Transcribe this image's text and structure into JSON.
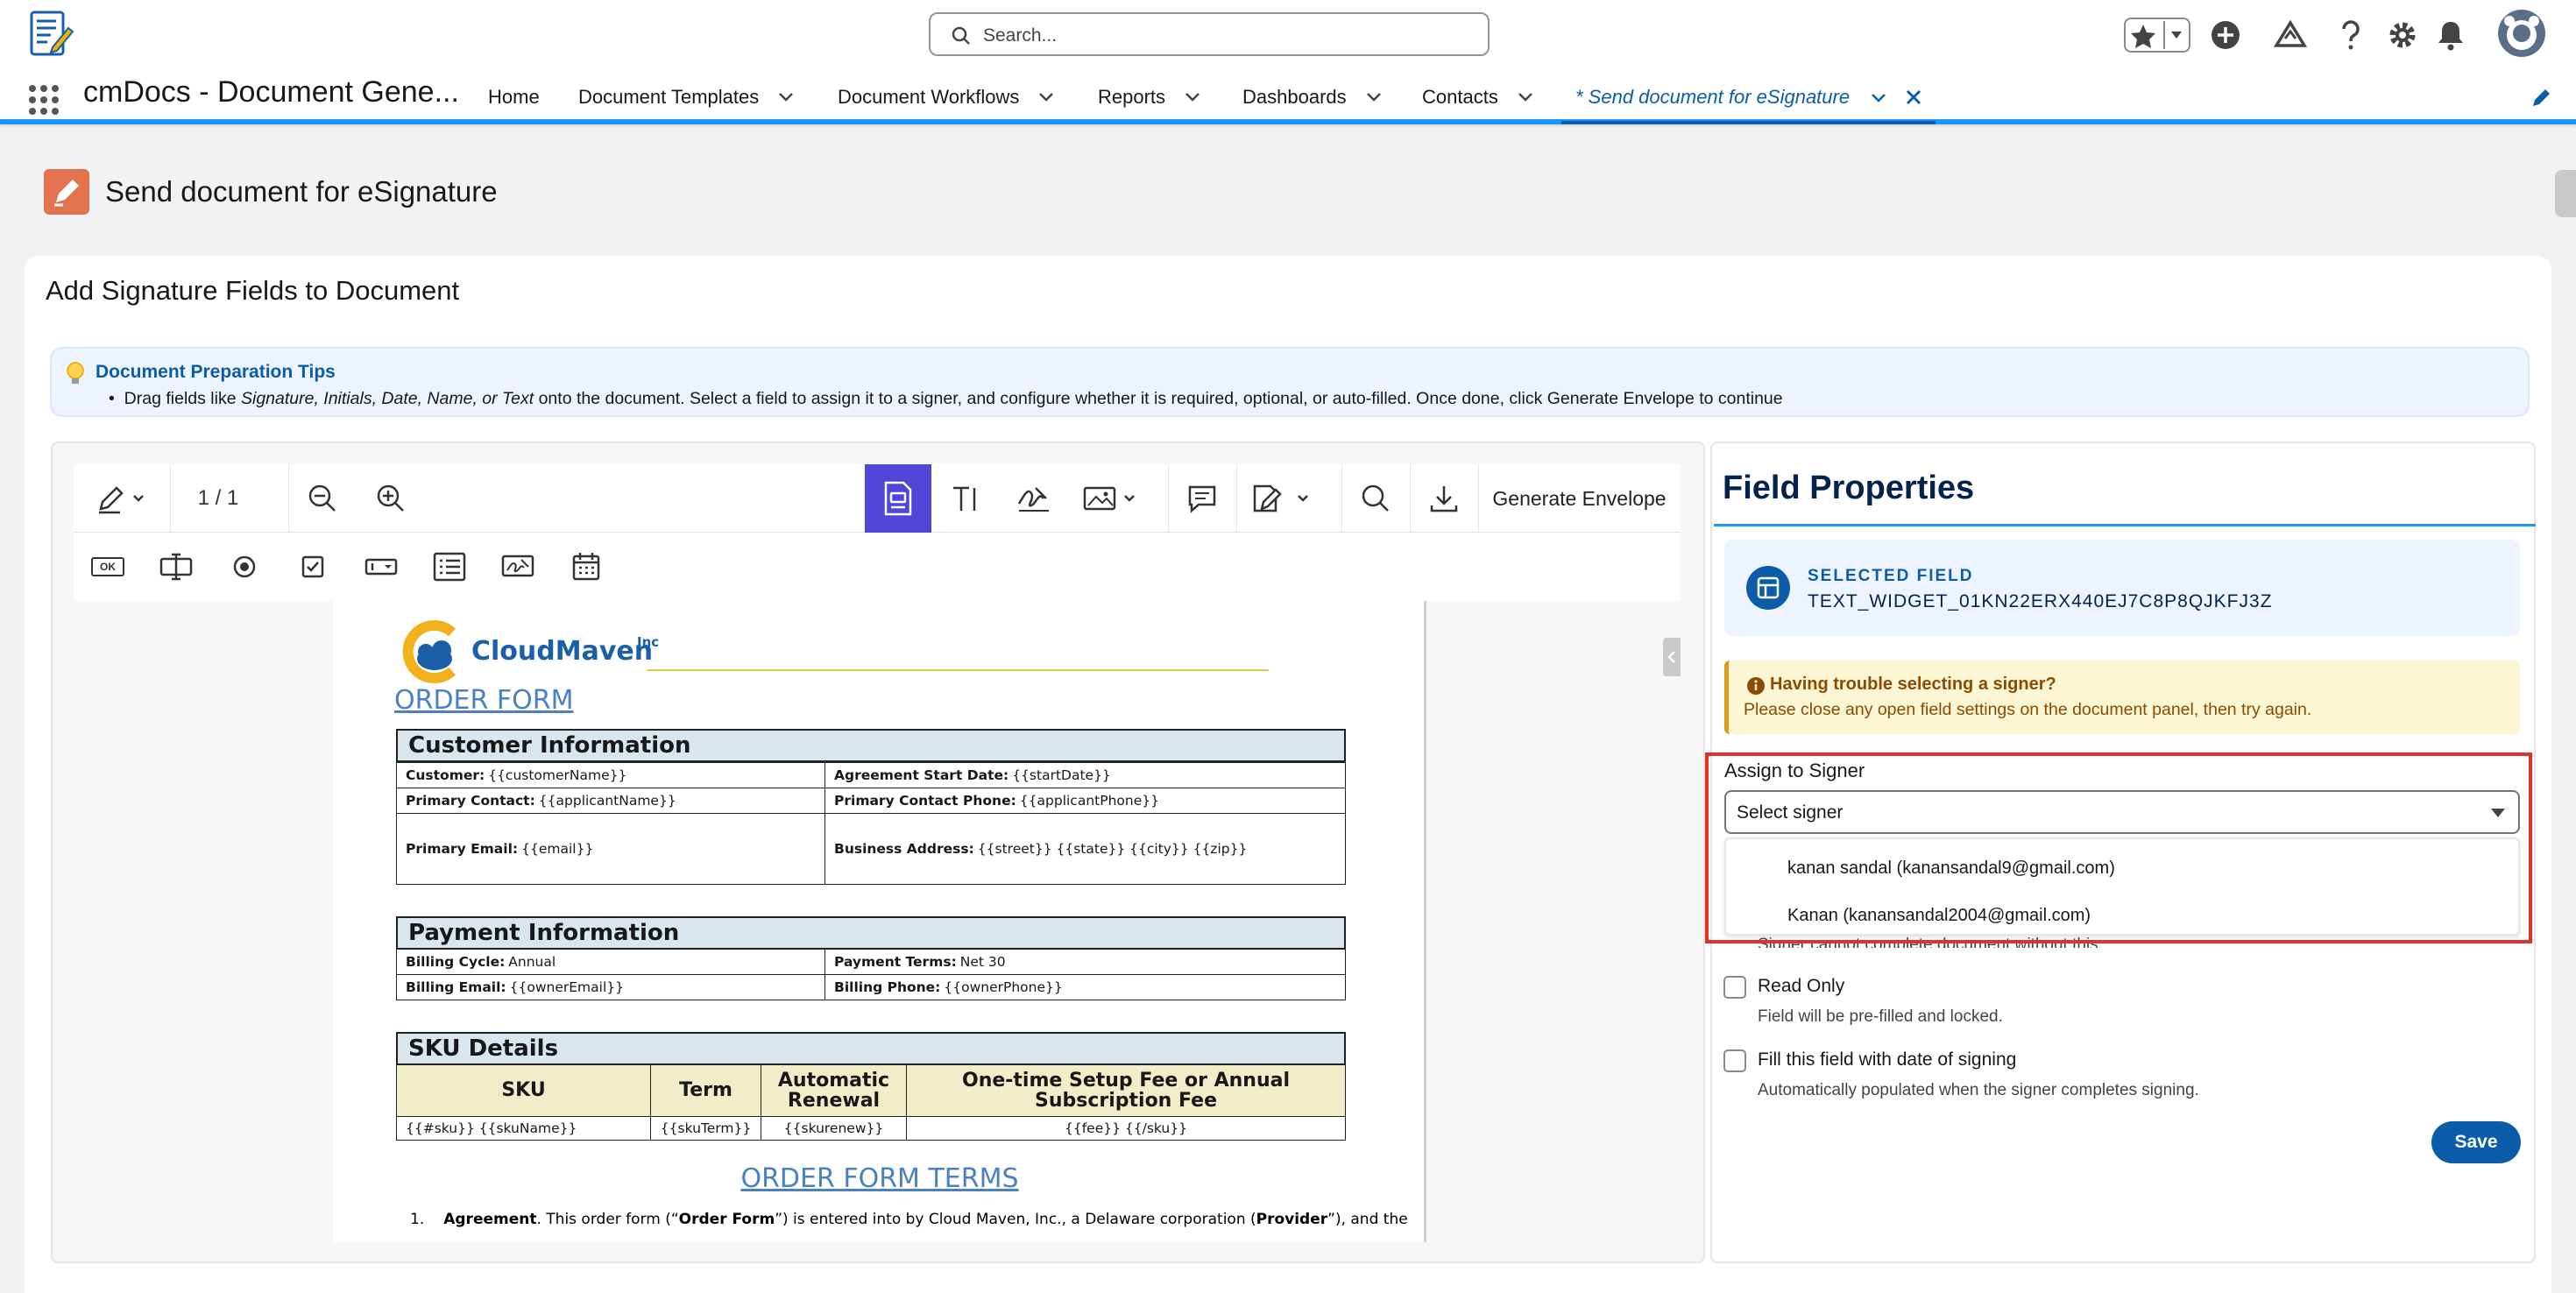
{
  "header": {
    "search_placeholder": "Search...",
    "app_name": "cmDocs - Document Gene..."
  },
  "nav": {
    "items": [
      "Home",
      "Document Templates",
      "Document Workflows",
      "Reports",
      "Dashboards",
      "Contacts"
    ],
    "active_tab": "* Send document for eSignature"
  },
  "page": {
    "title": "Send document for eSignature",
    "card_title": "Add Signature Fields to Document"
  },
  "tips": {
    "title": "Document Preparation Tips",
    "text_before": "Drag fields like ",
    "text_italic": "Signature, Initials, Date, Name, or Text",
    "text_after": " onto the document. Select a field to assign it to a signer, and configure whether it is required, optional, or auto-filled. Once done, click Generate Envelope to continue"
  },
  "toolbar": {
    "page_indicator": "1 / 1",
    "generate_label": "Generate Envelope",
    "ok_chip": "OK"
  },
  "document": {
    "logo_text": "CloudMaven",
    "logo_sup": "Inc",
    "order_form": "ORDER FORM",
    "customer_section": "Customer Information",
    "customer_rows": [
      {
        "l_label": "Customer:",
        "l_val": "{{customerName}}",
        "r_label": "Agreement Start Date:",
        "r_val": "{{startDate}}"
      },
      {
        "l_label": "Primary Contact:",
        "l_val": "{{applicantName}}",
        "r_label": "Primary Contact Phone:",
        "r_val": "{{applicantPhone}}"
      },
      {
        "l_label": "Primary Email:",
        "l_val": "{{email}}",
        "r_label": "Business Address:",
        "r_val": "{{street}} {{state}} {{city}} {{zip}}"
      }
    ],
    "payment_section": "Payment Information",
    "payment_rows": [
      {
        "l_label": "Billing Cycle:",
        "l_val": "Annual",
        "r_label": "Payment Terms:",
        "r_val": "Net 30"
      },
      {
        "l_label": "Billing Email:",
        "l_val": "{{ownerEmail}}",
        "r_label": "Billing Phone:",
        "r_val": "{{ownerPhone}}"
      }
    ],
    "sku_section": "SKU Details",
    "sku_headers": [
      "SKU",
      "Term",
      "Automatic Renewal",
      "One-time Setup Fee or Annual Subscription Fee"
    ],
    "sku_row": [
      "{{#sku}} {{skuName}}",
      "{{skuTerm}}",
      "{{skurenew}}",
      "{{fee}} {{/sku}}"
    ],
    "terms_title": "ORDER FORM TERMS",
    "terms_num": "1.",
    "terms_bold1": "Agreement",
    "terms_text1": ". This order form (“",
    "terms_bold2": "Order Form",
    "terms_text2": "”) is entered into by Cloud Maven, Inc., a Delaware corporation (",
    "terms_bold3": "Provider",
    "terms_text3": "”), and the"
  },
  "field_properties": {
    "title": "Field Properties",
    "selected_label": "SELECTED FIELD",
    "selected_value": "TEXT_WIDGET_01KN22ERX440EJ7C8P8QJKFJ3Z",
    "warn_title": "Having trouble selecting a signer?",
    "warn_text": "Please close any open field settings on the document panel, then try again.",
    "assign_label": "Assign to Signer",
    "select_value": "Select signer",
    "options": [
      "kanan sandal (kanansandal9@gmail.com)",
      "Kanan (kanansandal2004@gmail.com)"
    ],
    "hidden_hint": "Signer cannot complete document without this.",
    "read_only_label": "Read Only",
    "read_only_help": "Field will be pre-filled and locked.",
    "date_label": "Fill this field with date of signing",
    "date_help": "Automatically populated when the signer completes signing.",
    "save_label": "Save"
  },
  "colors": {
    "brand_blue": "#0b5cab",
    "active_tool": "#5146d8",
    "highlight_red": "#e0322b",
    "page_icon": "#e3734f"
  }
}
